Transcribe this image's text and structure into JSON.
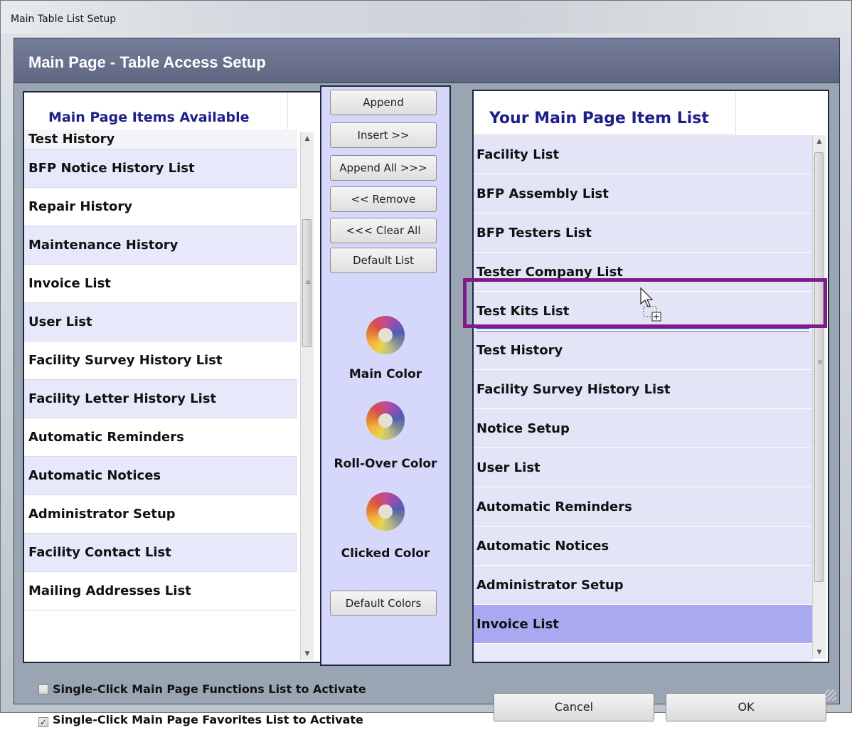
{
  "window": {
    "title": "Main Table List Setup"
  },
  "header": {
    "title": "Main Page - Table Access Setup"
  },
  "left_panel": {
    "title": "Main Page Items Available",
    "items": [
      "Test History",
      "BFP Notice History List",
      "Repair History",
      "Maintenance History",
      "Invoice List",
      "User List",
      "Facility Survey History List",
      "Facility Letter History List",
      "Automatic Reminders",
      "Automatic Notices",
      "Administrator Setup",
      "Facility Contact List",
      "Mailing Addresses List"
    ]
  },
  "middle": {
    "append": "Append",
    "insert": "Insert >>",
    "append_all": "Append All >>>",
    "remove": "<< Remove",
    "clear_all": "<<< Clear All",
    "default_list": "Default List",
    "main_color": "Main Color",
    "rollover_color": "Roll-Over Color",
    "clicked_color": "Clicked Color",
    "default_colors": "Default Colors"
  },
  "right_panel": {
    "title": "Your Main Page Item List",
    "items": [
      "Facility List",
      "BFP Assembly List",
      "BFP Testers List",
      "Tester Company List",
      "Test Kits List",
      "Test History",
      "Facility Survey History List",
      "Notice Setup",
      "User List",
      "Automatic Reminders",
      "Automatic Notices",
      "Administrator Setup",
      "Invoice List"
    ],
    "selected_item": "Invoice List"
  },
  "options": {
    "single_click_functions": {
      "label": "Single-Click Main Page Functions List to Activate",
      "checked": false
    },
    "single_click_favorites": {
      "label": "Single-Click Main Page Favorites List to Activate",
      "checked": true
    }
  },
  "buttons": {
    "cancel": "Cancel",
    "ok": "OK"
  },
  "colors": {
    "header": "#6a718d",
    "accent": "#1d1f8a",
    "highlight": "#7f1a8a",
    "list_alt": "#e8e8fb",
    "selected": "#a9a8f0"
  }
}
